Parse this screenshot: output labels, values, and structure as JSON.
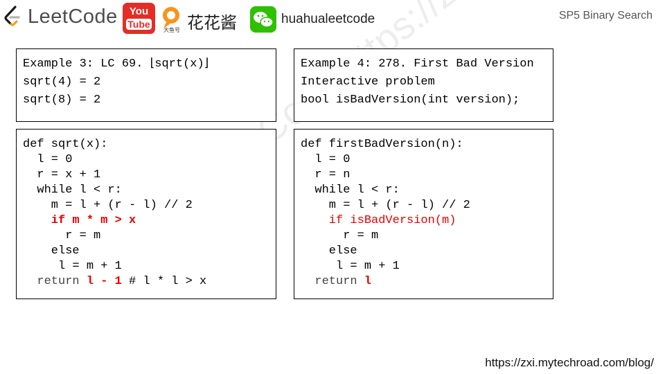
{
  "header": {
    "logo_text": "LeetCode",
    "youtube_you": "You",
    "youtube_tube": "Tube",
    "douyu_caption": "大鱼号",
    "channel_name": "花花酱",
    "wechat_id": "huahualeetcode",
    "section_title": "SP5 Binary Search"
  },
  "example3": {
    "title": "Example 3: LC 69. ⌊sqrt(x)⌋",
    "line2": "sqrt(4) = 2",
    "line3": "sqrt(8) = 2"
  },
  "example4": {
    "title": "Example 4: 278. First Bad Version",
    "line2": "Interactive problem",
    "line3": "bool isBadVersion(int version);"
  },
  "code3": {
    "l1": "def sqrt(x):",
    "l2": "  l = 0",
    "l3": "  r = x + 1",
    "l4": "  while l < r:",
    "l5": "    m = l + (r - l) // 2",
    "l6": "    if m * m > x",
    "l7": "      r = m",
    "l8": "    else",
    "l9": "     l = m + 1",
    "l10_kw": "  return ",
    "l10_red": "l - 1",
    "l10_rest": " # l * l > x"
  },
  "code4": {
    "l1": "def firstBadVersion(n):",
    "l2": "  l = 0",
    "l3": "  r = n",
    "l4": "  while l < r:",
    "l5": "    m = l + (r - l) // 2",
    "l6": "    if isBadVersion(m)",
    "l7": "      r = m",
    "l8": "    else",
    "l9": "     l = m + 1",
    "l10_kw": "  return ",
    "l10_red": "l"
  },
  "watermark": "花花酱 LeetCode https://zxi.mytechroad.com/blog/",
  "footer_url": "https://zxi.mytechroad.com/blog/",
  "colors": {
    "highlight": "#e60000",
    "youtube": "#e52d27",
    "wechat": "#2dc100"
  }
}
